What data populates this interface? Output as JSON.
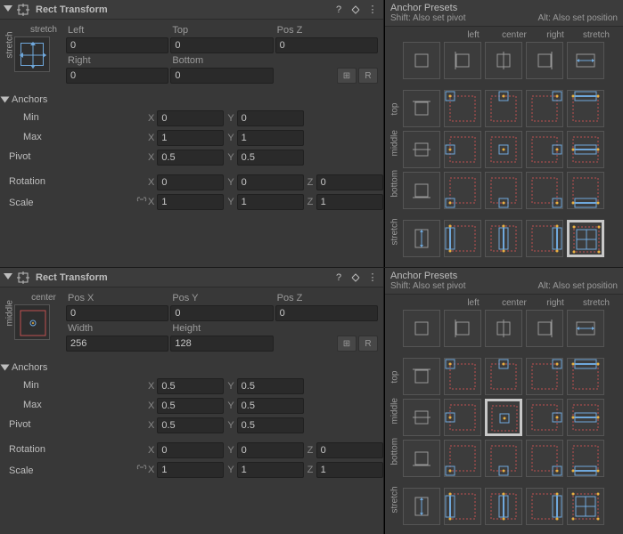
{
  "panel1": {
    "title": "Rect Transform",
    "anchor_preview": {
      "h": "stretch",
      "v": "stretch"
    },
    "fields": {
      "c1_label": "Left",
      "c1_val": "0",
      "c2_label": "Top",
      "c2_val": "0",
      "c3_label": "Pos Z",
      "c3_val": "0",
      "c4_label": "Right",
      "c4_val": "0",
      "c5_label": "Bottom",
      "c5_val": "0"
    },
    "anchors_label": "Anchors",
    "min_label": "Min",
    "min_x": "0",
    "min_y": "0",
    "max_label": "Max",
    "max_x": "1",
    "max_y": "1",
    "pivot_label": "Pivot",
    "pivot_x": "0.5",
    "pivot_y": "0.5",
    "rotation_label": "Rotation",
    "rot_x": "0",
    "rot_y": "0",
    "rot_z": "0",
    "scale_label": "Scale",
    "scale_x": "1",
    "scale_y": "1",
    "scale_z": "1",
    "blueprint_label": "⊞",
    "raw_label": "R"
  },
  "panel2": {
    "title": "Rect Transform",
    "anchor_preview": {
      "h": "center",
      "v": "middle"
    },
    "fields": {
      "c1_label": "Pos X",
      "c1_val": "0",
      "c2_label": "Pos Y",
      "c2_val": "0",
      "c3_label": "Pos Z",
      "c3_val": "0",
      "c4_label": "Width",
      "c4_val": "256",
      "c5_label": "Height",
      "c5_val": "128"
    },
    "anchors_label": "Anchors",
    "min_label": "Min",
    "min_x": "0.5",
    "min_y": "0.5",
    "max_label": "Max",
    "max_x": "0.5",
    "max_y": "0.5",
    "pivot_label": "Pivot",
    "pivot_x": "0.5",
    "pivot_y": "0.5",
    "rotation_label": "Rotation",
    "rot_x": "0",
    "rot_y": "0",
    "rot_z": "0",
    "scale_label": "Scale",
    "scale_x": "1",
    "scale_y": "1",
    "scale_z": "1",
    "blueprint_label": "⊞",
    "raw_label": "R"
  },
  "presets": {
    "title": "Anchor Presets",
    "hint_shift": "Shift: Also set pivot",
    "hint_alt": "Alt: Also set position",
    "cols": [
      "left",
      "center",
      "right",
      "stretch"
    ],
    "rows": [
      "top",
      "middle",
      "bottom",
      "stretch"
    ]
  },
  "selected1": {
    "row": "stretch",
    "col": "stretch"
  },
  "selected2": {
    "row": "middle",
    "col": "center"
  },
  "axis": {
    "x": "X",
    "y": "Y",
    "z": "Z"
  }
}
